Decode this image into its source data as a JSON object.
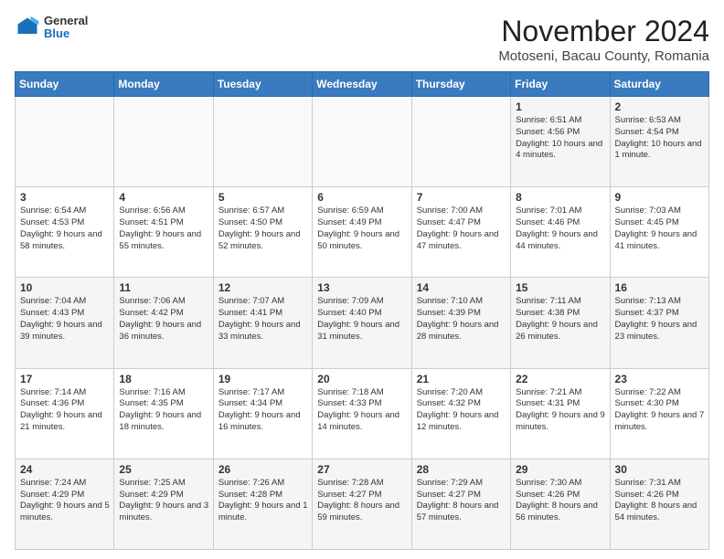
{
  "logo": {
    "general": "General",
    "blue": "Blue"
  },
  "header": {
    "month": "November 2024",
    "location": "Motoseni, Bacau County, Romania"
  },
  "weekdays": [
    "Sunday",
    "Monday",
    "Tuesday",
    "Wednesday",
    "Thursday",
    "Friday",
    "Saturday"
  ],
  "weeks": [
    [
      {
        "day": "",
        "info": ""
      },
      {
        "day": "",
        "info": ""
      },
      {
        "day": "",
        "info": ""
      },
      {
        "day": "",
        "info": ""
      },
      {
        "day": "",
        "info": ""
      },
      {
        "day": "1",
        "info": "Sunrise: 6:51 AM\nSunset: 4:56 PM\nDaylight: 10 hours and 4 minutes."
      },
      {
        "day": "2",
        "info": "Sunrise: 6:53 AM\nSunset: 4:54 PM\nDaylight: 10 hours and 1 minute."
      }
    ],
    [
      {
        "day": "3",
        "info": "Sunrise: 6:54 AM\nSunset: 4:53 PM\nDaylight: 9 hours and 58 minutes."
      },
      {
        "day": "4",
        "info": "Sunrise: 6:56 AM\nSunset: 4:51 PM\nDaylight: 9 hours and 55 minutes."
      },
      {
        "day": "5",
        "info": "Sunrise: 6:57 AM\nSunset: 4:50 PM\nDaylight: 9 hours and 52 minutes."
      },
      {
        "day": "6",
        "info": "Sunrise: 6:59 AM\nSunset: 4:49 PM\nDaylight: 9 hours and 50 minutes."
      },
      {
        "day": "7",
        "info": "Sunrise: 7:00 AM\nSunset: 4:47 PM\nDaylight: 9 hours and 47 minutes."
      },
      {
        "day": "8",
        "info": "Sunrise: 7:01 AM\nSunset: 4:46 PM\nDaylight: 9 hours and 44 minutes."
      },
      {
        "day": "9",
        "info": "Sunrise: 7:03 AM\nSunset: 4:45 PM\nDaylight: 9 hours and 41 minutes."
      }
    ],
    [
      {
        "day": "10",
        "info": "Sunrise: 7:04 AM\nSunset: 4:43 PM\nDaylight: 9 hours and 39 minutes."
      },
      {
        "day": "11",
        "info": "Sunrise: 7:06 AM\nSunset: 4:42 PM\nDaylight: 9 hours and 36 minutes."
      },
      {
        "day": "12",
        "info": "Sunrise: 7:07 AM\nSunset: 4:41 PM\nDaylight: 9 hours and 33 minutes."
      },
      {
        "day": "13",
        "info": "Sunrise: 7:09 AM\nSunset: 4:40 PM\nDaylight: 9 hours and 31 minutes."
      },
      {
        "day": "14",
        "info": "Sunrise: 7:10 AM\nSunset: 4:39 PM\nDaylight: 9 hours and 28 minutes."
      },
      {
        "day": "15",
        "info": "Sunrise: 7:11 AM\nSunset: 4:38 PM\nDaylight: 9 hours and 26 minutes."
      },
      {
        "day": "16",
        "info": "Sunrise: 7:13 AM\nSunset: 4:37 PM\nDaylight: 9 hours and 23 minutes."
      }
    ],
    [
      {
        "day": "17",
        "info": "Sunrise: 7:14 AM\nSunset: 4:36 PM\nDaylight: 9 hours and 21 minutes."
      },
      {
        "day": "18",
        "info": "Sunrise: 7:16 AM\nSunset: 4:35 PM\nDaylight: 9 hours and 18 minutes."
      },
      {
        "day": "19",
        "info": "Sunrise: 7:17 AM\nSunset: 4:34 PM\nDaylight: 9 hours and 16 minutes."
      },
      {
        "day": "20",
        "info": "Sunrise: 7:18 AM\nSunset: 4:33 PM\nDaylight: 9 hours and 14 minutes."
      },
      {
        "day": "21",
        "info": "Sunrise: 7:20 AM\nSunset: 4:32 PM\nDaylight: 9 hours and 12 minutes."
      },
      {
        "day": "22",
        "info": "Sunrise: 7:21 AM\nSunset: 4:31 PM\nDaylight: 9 hours and 9 minutes."
      },
      {
        "day": "23",
        "info": "Sunrise: 7:22 AM\nSunset: 4:30 PM\nDaylight: 9 hours and 7 minutes."
      }
    ],
    [
      {
        "day": "24",
        "info": "Sunrise: 7:24 AM\nSunset: 4:29 PM\nDaylight: 9 hours and 5 minutes."
      },
      {
        "day": "25",
        "info": "Sunrise: 7:25 AM\nSunset: 4:29 PM\nDaylight: 9 hours and 3 minutes."
      },
      {
        "day": "26",
        "info": "Sunrise: 7:26 AM\nSunset: 4:28 PM\nDaylight: 9 hours and 1 minute."
      },
      {
        "day": "27",
        "info": "Sunrise: 7:28 AM\nSunset: 4:27 PM\nDaylight: 8 hours and 59 minutes."
      },
      {
        "day": "28",
        "info": "Sunrise: 7:29 AM\nSunset: 4:27 PM\nDaylight: 8 hours and 57 minutes."
      },
      {
        "day": "29",
        "info": "Sunrise: 7:30 AM\nSunset: 4:26 PM\nDaylight: 8 hours and 56 minutes."
      },
      {
        "day": "30",
        "info": "Sunrise: 7:31 AM\nSunset: 4:26 PM\nDaylight: 8 hours and 54 minutes."
      }
    ]
  ]
}
